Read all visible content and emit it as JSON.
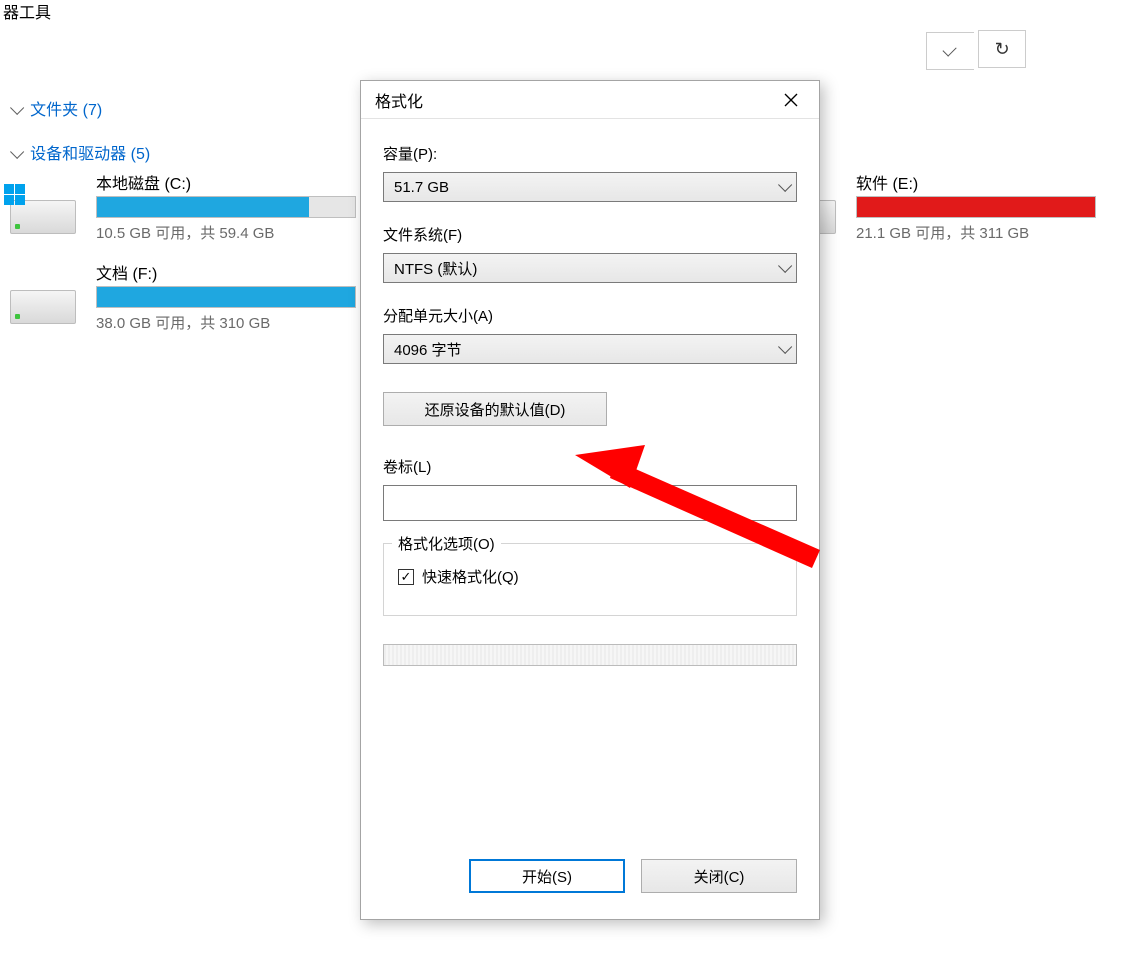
{
  "header": {
    "fragment": "器工具"
  },
  "sections": {
    "folders": {
      "label": "文件夹 (7)"
    },
    "devices": {
      "label": "设备和驱动器 (5)"
    }
  },
  "drives": [
    {
      "id": "c",
      "name": "本地磁盘 (C:)",
      "status": "10.5 GB 可用，共 59.4 GB",
      "fill_pct": 82,
      "fill_color": "#1fa7e0",
      "has_win_badge": true
    },
    {
      "id": "e",
      "name": "软件 (E:)",
      "status": "21.1 GB 可用，共 311 GB",
      "fill_pct": 100,
      "fill_color": "#e11a1a",
      "has_win_badge": false
    },
    {
      "id": "f",
      "name": "文档 (F:)",
      "status": "38.0 GB 可用，共 310 GB",
      "fill_pct": 100,
      "fill_color": "#1fa7e0",
      "has_win_badge": false
    }
  ],
  "dialog": {
    "title": "格式化",
    "capacity": {
      "label": "容量(P):",
      "value": "51.7 GB"
    },
    "filesystem": {
      "label": "文件系统(F)",
      "value": "NTFS (默认)"
    },
    "alloc": {
      "label": "分配单元大小(A)",
      "value": "4096 字节"
    },
    "restore_defaults": "还原设备的默认值(D)",
    "volume": {
      "label": "卷标(L)",
      "value": ""
    },
    "options_group": "格式化选项(O)",
    "quick_format": {
      "label": "快速格式化(Q)",
      "checked": true
    },
    "start": "开始(S)",
    "close": "关闭(C)"
  },
  "colors": {
    "accent": "#0078d7"
  }
}
